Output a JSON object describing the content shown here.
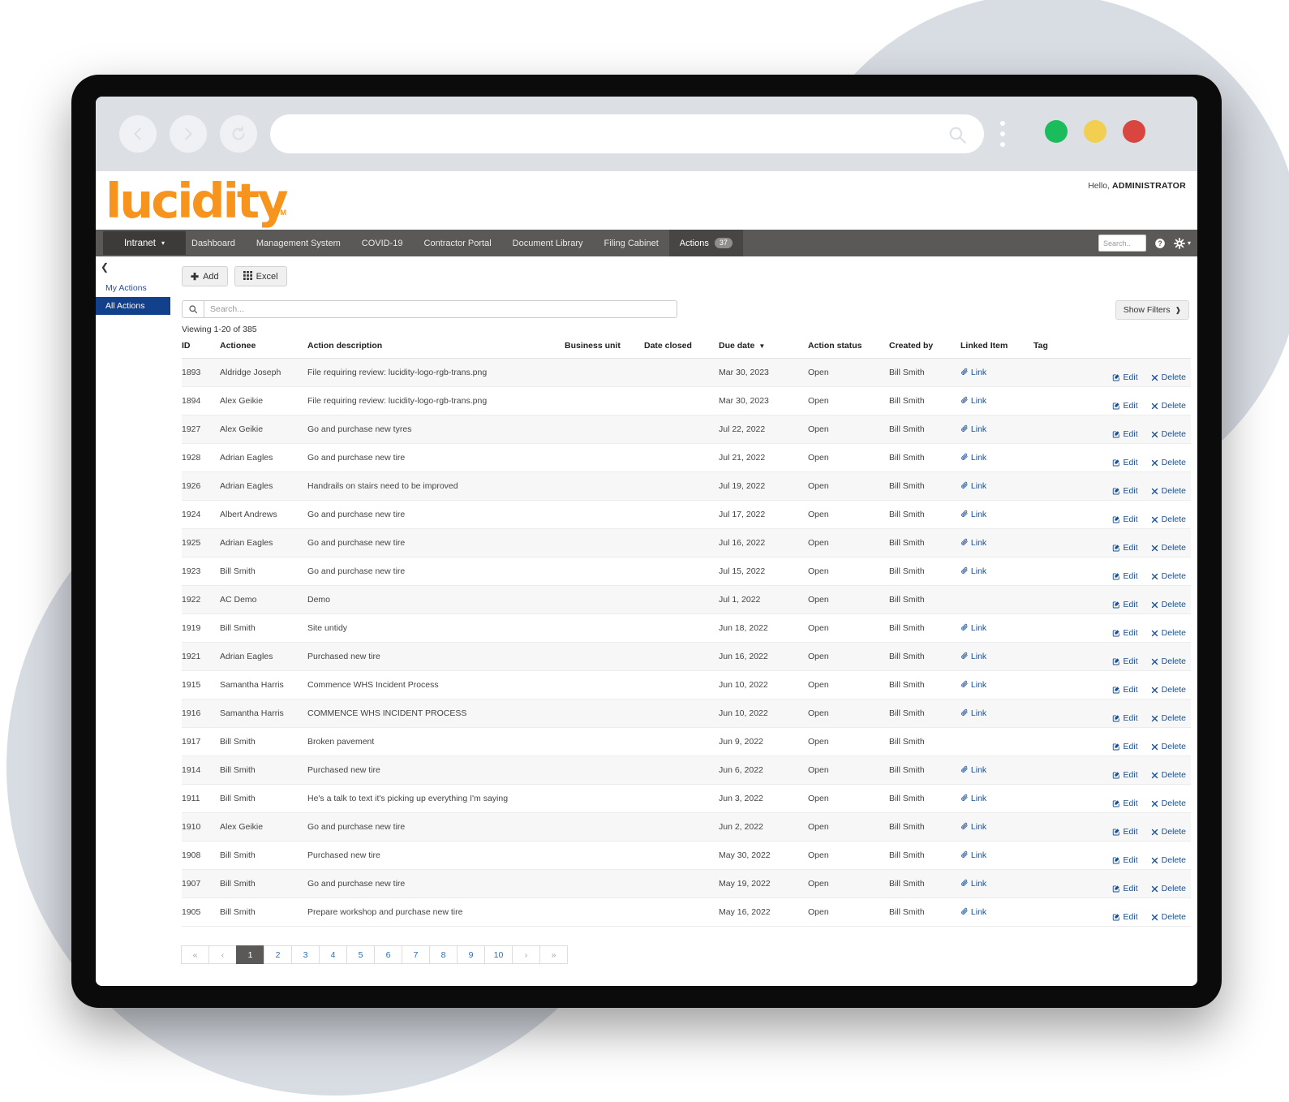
{
  "browser": {
    "back_icon": "chevron-left-icon",
    "forward_icon": "chevron-right-icon",
    "reload_icon": "reload-icon",
    "url_value": "",
    "url_placeholder": "",
    "search_icon": "search-icon",
    "menu_icon": "kebab-menu-icon",
    "window_dots": [
      "#1abc5b",
      "#f2cf50",
      "#d9453f"
    ]
  },
  "header": {
    "logo_text": "lucidity",
    "logo_tm": "TM",
    "logo_color": "#f7941e",
    "greeting_prefix": "Hello, ",
    "greeting_user": "ADMINISTRATOR"
  },
  "nav": {
    "site_selector": "Intranet",
    "site_selector_caret": "caret-down-icon",
    "items": [
      {
        "label": "Dashboard",
        "active": false,
        "badge": ""
      },
      {
        "label": "Management System",
        "active": false,
        "badge": ""
      },
      {
        "label": "COVID-19",
        "active": false,
        "badge": ""
      },
      {
        "label": "Contractor Portal",
        "active": false,
        "badge": ""
      },
      {
        "label": "Document Library",
        "active": false,
        "badge": ""
      },
      {
        "label": "Filing Cabinet",
        "active": false,
        "badge": ""
      },
      {
        "label": "Actions",
        "active": true,
        "badge": "37"
      }
    ],
    "search_placeholder": "Search..",
    "help_icon": "help-circle-icon",
    "settings_icon": "gear-icon"
  },
  "sidebar": {
    "collapse_icon": "chevron-left-icon",
    "items": [
      {
        "label": "My Actions",
        "active": false
      },
      {
        "label": "All Actions",
        "active": true
      }
    ]
  },
  "toolbar": {
    "add_label": "Add",
    "add_icon": "plus-icon",
    "excel_label": "Excel",
    "excel_icon": "grid-icon"
  },
  "search": {
    "icon": "search-icon",
    "placeholder": "Search...",
    "value": ""
  },
  "filters": {
    "label": "Show Filters",
    "caret": "chevron-down-icon"
  },
  "viewing_text": "Viewing 1-20 of 385",
  "table": {
    "columns": [
      "ID",
      "Actionee",
      "Action description",
      "Business unit",
      "Date closed",
      "Due date",
      "Action status",
      "Created by",
      "Linked Item",
      "Tag",
      ""
    ],
    "sorted_column": "Due date",
    "sort_direction": "desc",
    "sort_icon": "caret-down-icon",
    "row_edit_label": "Edit",
    "row_edit_icon": "edit-square-icon",
    "row_delete_label": "Delete",
    "row_delete_icon": "x-icon",
    "link_label": "Link",
    "link_icon": "paperclip-icon",
    "rows": [
      {
        "id": "1893",
        "actionee": "Aldridge Joseph",
        "description": "File requiring review: lucidity-logo-rgb-trans.png",
        "business_unit": "",
        "date_closed": "",
        "due_date": "Mar 30, 2023",
        "status": "Open",
        "created_by": "Bill Smith",
        "linked": "Link",
        "tag": ""
      },
      {
        "id": "1894",
        "actionee": "Alex Geikie",
        "description": "File requiring review: lucidity-logo-rgb-trans.png",
        "business_unit": "",
        "date_closed": "",
        "due_date": "Mar 30, 2023",
        "status": "Open",
        "created_by": "Bill Smith",
        "linked": "Link",
        "tag": ""
      },
      {
        "id": "1927",
        "actionee": "Alex Geikie",
        "description": "Go and purchase new tyres",
        "business_unit": "",
        "date_closed": "",
        "due_date": "Jul 22, 2022",
        "status": "Open",
        "created_by": "Bill Smith",
        "linked": "Link",
        "tag": ""
      },
      {
        "id": "1928",
        "actionee": "Adrian Eagles",
        "description": "Go and purchase new tire",
        "business_unit": "",
        "date_closed": "",
        "due_date": "Jul 21, 2022",
        "status": "Open",
        "created_by": "Bill Smith",
        "linked": "Link",
        "tag": ""
      },
      {
        "id": "1926",
        "actionee": "Adrian Eagles",
        "description": "Handrails on stairs need to be improved",
        "business_unit": "",
        "date_closed": "",
        "due_date": "Jul 19, 2022",
        "status": "Open",
        "created_by": "Bill Smith",
        "linked": "Link",
        "tag": ""
      },
      {
        "id": "1924",
        "actionee": "Albert Andrews",
        "description": "Go and purchase new tire",
        "business_unit": "",
        "date_closed": "",
        "due_date": "Jul 17, 2022",
        "status": "Open",
        "created_by": "Bill Smith",
        "linked": "Link",
        "tag": ""
      },
      {
        "id": "1925",
        "actionee": "Adrian Eagles",
        "description": "Go and purchase new tire",
        "business_unit": "",
        "date_closed": "",
        "due_date": "Jul 16, 2022",
        "status": "Open",
        "created_by": "Bill Smith",
        "linked": "Link",
        "tag": ""
      },
      {
        "id": "1923",
        "actionee": "Bill Smith",
        "description": "Go and purchase new tire",
        "business_unit": "",
        "date_closed": "",
        "due_date": "Jul 15, 2022",
        "status": "Open",
        "created_by": "Bill Smith",
        "linked": "Link",
        "tag": ""
      },
      {
        "id": "1922",
        "actionee": "AC Demo",
        "description": "Demo",
        "business_unit": "",
        "date_closed": "",
        "due_date": "Jul 1, 2022",
        "status": "Open",
        "created_by": "Bill Smith",
        "linked": "",
        "tag": ""
      },
      {
        "id": "1919",
        "actionee": "Bill Smith",
        "description": "Site untidy",
        "business_unit": "",
        "date_closed": "",
        "due_date": "Jun 18, 2022",
        "status": "Open",
        "created_by": "Bill Smith",
        "linked": "Link",
        "tag": ""
      },
      {
        "id": "1921",
        "actionee": "Adrian Eagles",
        "description": "Purchased new tire",
        "business_unit": "",
        "date_closed": "",
        "due_date": "Jun 16, 2022",
        "status": "Open",
        "created_by": "Bill Smith",
        "linked": "Link",
        "tag": ""
      },
      {
        "id": "1915",
        "actionee": "Samantha Harris",
        "description": "Commence WHS Incident Process",
        "business_unit": "",
        "date_closed": "",
        "due_date": "Jun 10, 2022",
        "status": "Open",
        "created_by": "Bill Smith",
        "linked": "Link",
        "tag": ""
      },
      {
        "id": "1916",
        "actionee": "Samantha Harris",
        "description": "COMMENCE WHS INCIDENT PROCESS",
        "business_unit": "",
        "date_closed": "",
        "due_date": "Jun 10, 2022",
        "status": "Open",
        "created_by": "Bill Smith",
        "linked": "Link",
        "tag": ""
      },
      {
        "id": "1917",
        "actionee": "Bill Smith",
        "description": "Broken pavement",
        "business_unit": "",
        "date_closed": "",
        "due_date": "Jun 9, 2022",
        "status": "Open",
        "created_by": "Bill Smith",
        "linked": "",
        "tag": ""
      },
      {
        "id": "1914",
        "actionee": "Bill Smith",
        "description": "Purchased new tire",
        "business_unit": "",
        "date_closed": "",
        "due_date": "Jun 6, 2022",
        "status": "Open",
        "created_by": "Bill Smith",
        "linked": "Link",
        "tag": ""
      },
      {
        "id": "1911",
        "actionee": "Bill Smith",
        "description": "He's a talk to text it's picking up everything I'm saying",
        "business_unit": "",
        "date_closed": "",
        "due_date": "Jun 3, 2022",
        "status": "Open",
        "created_by": "Bill Smith",
        "linked": "Link",
        "tag": ""
      },
      {
        "id": "1910",
        "actionee": "Alex Geikie",
        "description": "Go and purchase new tire",
        "business_unit": "",
        "date_closed": "",
        "due_date": "Jun 2, 2022",
        "status": "Open",
        "created_by": "Bill Smith",
        "linked": "Link",
        "tag": ""
      },
      {
        "id": "1908",
        "actionee": "Bill Smith",
        "description": "Purchased new tire",
        "business_unit": "",
        "date_closed": "",
        "due_date": "May 30, 2022",
        "status": "Open",
        "created_by": "Bill Smith",
        "linked": "Link",
        "tag": ""
      },
      {
        "id": "1907",
        "actionee": "Bill Smith",
        "description": "Go and purchase new tire",
        "business_unit": "",
        "date_closed": "",
        "due_date": "May 19, 2022",
        "status": "Open",
        "created_by": "Bill Smith",
        "linked": "Link",
        "tag": ""
      },
      {
        "id": "1905",
        "actionee": "Bill Smith",
        "description": "Prepare workshop and purchase new tire",
        "business_unit": "",
        "date_closed": "",
        "due_date": "May 16, 2022",
        "status": "Open",
        "created_by": "Bill Smith",
        "linked": "Link",
        "tag": ""
      }
    ]
  },
  "pagination": {
    "first": "«",
    "prev": "‹",
    "pages": [
      "1",
      "2",
      "3",
      "4",
      "5",
      "6",
      "7",
      "8",
      "9",
      "10"
    ],
    "active_page": "1",
    "next": "›",
    "last": "»"
  }
}
